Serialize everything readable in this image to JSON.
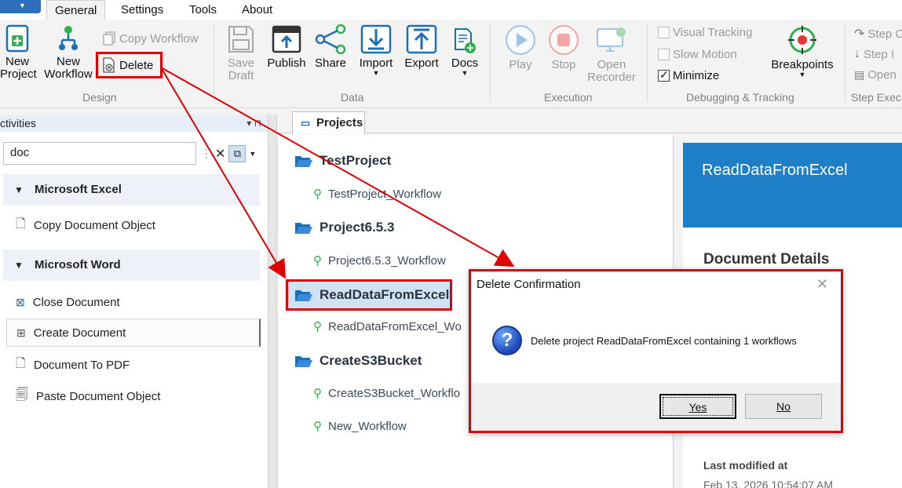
{
  "app": {
    "tabs": [
      {
        "label": "General",
        "active": true
      },
      {
        "label": "Settings",
        "active": false
      },
      {
        "label": "Tools",
        "active": false
      },
      {
        "label": "About",
        "active": false
      }
    ]
  },
  "ribbon": {
    "design": {
      "label": "Design",
      "new_project": "New\nProject",
      "new_project_l1": "New",
      "new_project_l2": "Project",
      "new_workflow_l1": "New",
      "new_workflow_l2": "Workflow",
      "copy_workflow": "Copy Workflow",
      "delete": "Delete"
    },
    "data": {
      "label": "Data",
      "save_l1": "Save",
      "save_l2": "Draft",
      "publish": "Publish",
      "share": "Share",
      "import": "Import",
      "export": "Export",
      "docs": "Docs"
    },
    "execution": {
      "label": "Execution",
      "play": "Play",
      "stop": "Stop",
      "open_l1": "Open",
      "open_l2": "Recorder"
    },
    "debugging": {
      "label": "Debugging & Tracking",
      "visual_tracking": "Visual Tracking",
      "slow_motion": "Slow Motion",
      "minimize": "Minimize",
      "minimize_checked": true,
      "breakpoints": "Breakpoints"
    },
    "step": {
      "label": "Step Exec",
      "step_over": "Step C",
      "step_into": "Step I",
      "open": "Open"
    }
  },
  "activities": {
    "header": "ctivities",
    "search_value": "doc",
    "categories": [
      {
        "name": "Microsoft Excel",
        "items": [
          "Copy Document Object"
        ]
      },
      {
        "name": "Microsoft Word",
        "items": [
          "Close Document",
          "Create Document",
          "Document To PDF",
          "Paste Document Object"
        ]
      }
    ]
  },
  "projects": {
    "tab_label": "Projects",
    "items": [
      {
        "name": "TestProject",
        "workflow": "TestProject_Workflow"
      },
      {
        "name": "Project6.5.3",
        "workflow": "Project6.5.3_Workflow"
      },
      {
        "name": "ReadDataFromExcel",
        "workflow": "ReadDataFromExcel_Wo",
        "selected": true
      },
      {
        "name": "CreateS3Bucket",
        "workflow": "CreateS3Bucket_Workflo"
      }
    ],
    "extra_workflow": "New_Workflow"
  },
  "details": {
    "title": "ReadDataFromExcel",
    "section": "Document Details",
    "last_modified_label": "Last modified at",
    "last_modified_value": "Feb 13, 2026 10:54:07 AM"
  },
  "dialog": {
    "title": "Delete Confirmation",
    "message": "Delete project ReadDataFromExcel containing 1 workflows",
    "yes_label": "Yes",
    "no_label": "No"
  },
  "colors": {
    "accent": "#1f7fc6",
    "highlight": "#e00000",
    "ribbon_icon": "#1b6fb5",
    "green": "#2bb24c"
  }
}
